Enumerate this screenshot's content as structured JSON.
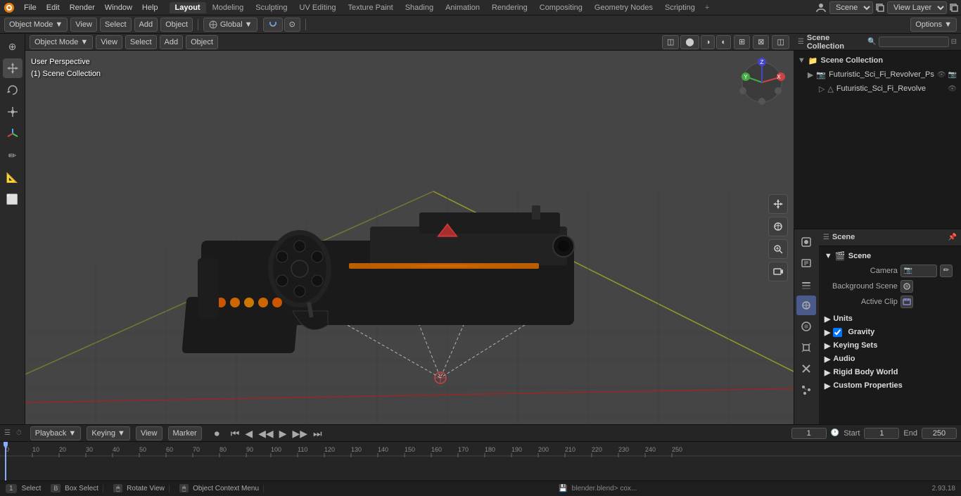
{
  "topMenu": {
    "menuItems": [
      "File",
      "Edit",
      "Render",
      "Window",
      "Help"
    ],
    "workspaceTabs": [
      "Layout",
      "Modeling",
      "Sculpting",
      "UV Editing",
      "Texture Paint",
      "Shading",
      "Animation",
      "Rendering",
      "Compositing",
      "Geometry Nodes",
      "Scripting"
    ],
    "activeTab": "Layout",
    "sceneLabel": "Scene",
    "viewLayerLabel": "View Layer"
  },
  "toolbar": {
    "modeLabel": "Object Mode",
    "viewLabel": "View",
    "selectLabel": "Select",
    "addLabel": "Add",
    "objectLabel": "Object",
    "transformLabel": "Global",
    "optionsLabel": "Options"
  },
  "viewport": {
    "perspLabel": "User Perspective",
    "collectionLabel": "(1) Scene Collection",
    "info1": "User Perspective",
    "info2": "(1) Scene Collection"
  },
  "outliner": {
    "title": "Scene Collection",
    "searchPlaceholder": "",
    "items": [
      {
        "label": "Scene Collection",
        "level": 0,
        "icon": "📁",
        "type": "collection"
      },
      {
        "label": "Futuristic_Sci_Fi_Revolver_Ps",
        "level": 1,
        "icon": "📷",
        "type": "object",
        "visible": true,
        "selected": true
      },
      {
        "label": "Futuristic_Sci_Fi_Revolve",
        "level": 2,
        "icon": "△",
        "type": "mesh",
        "visible": true
      }
    ]
  },
  "sceneProps": {
    "panelTitle": "Scene",
    "sectionTitle": "Scene",
    "cameraLabel": "Camera",
    "backgroundSceneLabel": "Background Scene",
    "activeClipLabel": "Active Clip",
    "sections": [
      {
        "label": "Units",
        "collapsed": true
      },
      {
        "label": "Gravity",
        "collapsed": false,
        "checked": true
      },
      {
        "label": "Keying Sets",
        "collapsed": true
      },
      {
        "label": "Audio",
        "collapsed": true
      },
      {
        "label": "Rigid Body World",
        "collapsed": true
      },
      {
        "label": "Custom Properties",
        "collapsed": true
      }
    ]
  },
  "timeline": {
    "playbackLabel": "Playback",
    "keyingLabel": "Keying",
    "viewLabel": "View",
    "markerLabel": "Marker",
    "currentFrame": "1",
    "startFrame": "1",
    "endFrame": "250",
    "startLabel": "Start",
    "endLabel": "End",
    "frameMarks": [
      "0",
      "10",
      "20",
      "30",
      "40",
      "50",
      "60",
      "70",
      "80",
      "90",
      "100",
      "110",
      "120",
      "130",
      "140",
      "150",
      "160",
      "170",
      "180",
      "190",
      "200",
      "210",
      "220",
      "230",
      "240",
      "250"
    ]
  },
  "statusBar": {
    "selectLabel": "Select",
    "boxSelectLabel": "Box Select",
    "rotateViewLabel": "Rotate View",
    "objectContextLabel": "Object Context Menu",
    "fileName": "blender.blend> cox...",
    "version": "2.93.18"
  },
  "icons": {
    "expand": "▶",
    "collapse": "▼",
    "cursor": "⊕",
    "move": "✥",
    "rotate": "↻",
    "scale": "⊞",
    "transform": "⊟",
    "visible": "👁",
    "camera": "📷",
    "mesh": "▲",
    "collection": "📁",
    "scene": "🎬",
    "filmclip": "🎞",
    "search": "🔍",
    "filter": "⊟"
  }
}
